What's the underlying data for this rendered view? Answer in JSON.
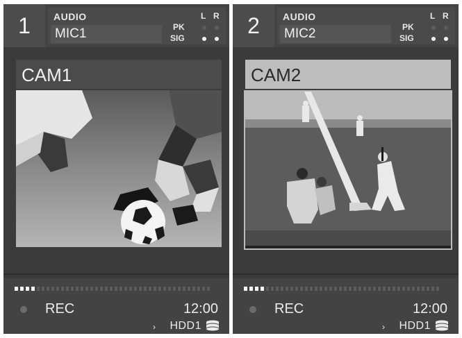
{
  "channels": [
    {
      "number": "1",
      "audio_label": "AUDIO",
      "mic": "MIC1",
      "meter": {
        "l_label": "L",
        "r_label": "R",
        "pk_label": "PK",
        "sig_label": "SIG",
        "pk_l": false,
        "pk_r": false,
        "sig_l": true,
        "sig_r": true
      },
      "camera": "CAM1",
      "scene": "soccer",
      "rec_label": "REC",
      "timecode": "12:00",
      "drive_arrow": "›",
      "drive": "HDD1",
      "level_on_blocks": 4,
      "level_total_blocks": 40,
      "selected": false
    },
    {
      "number": "2",
      "audio_label": "AUDIO",
      "mic": "MIC2",
      "meter": {
        "l_label": "L",
        "r_label": "R",
        "pk_label": "PK",
        "sig_label": "SIG",
        "pk_l": false,
        "pk_r": false,
        "sig_l": true,
        "sig_r": true
      },
      "camera": "CAM2",
      "scene": "baseball",
      "rec_label": "REC",
      "timecode": "12:00",
      "drive_arrow": "›",
      "drive": "HDD1",
      "level_on_blocks": 4,
      "level_total_blocks": 40,
      "selected": true
    }
  ],
  "colors": {
    "panel": "#3b3b3b",
    "header": "#434343",
    "selected_header": "#bdbdbd",
    "active": "#f5f5f5",
    "inactive": "#5c5c5c"
  },
  "icons": {
    "drive": "disk-stack-icon",
    "rec": "record-dot-icon"
  }
}
